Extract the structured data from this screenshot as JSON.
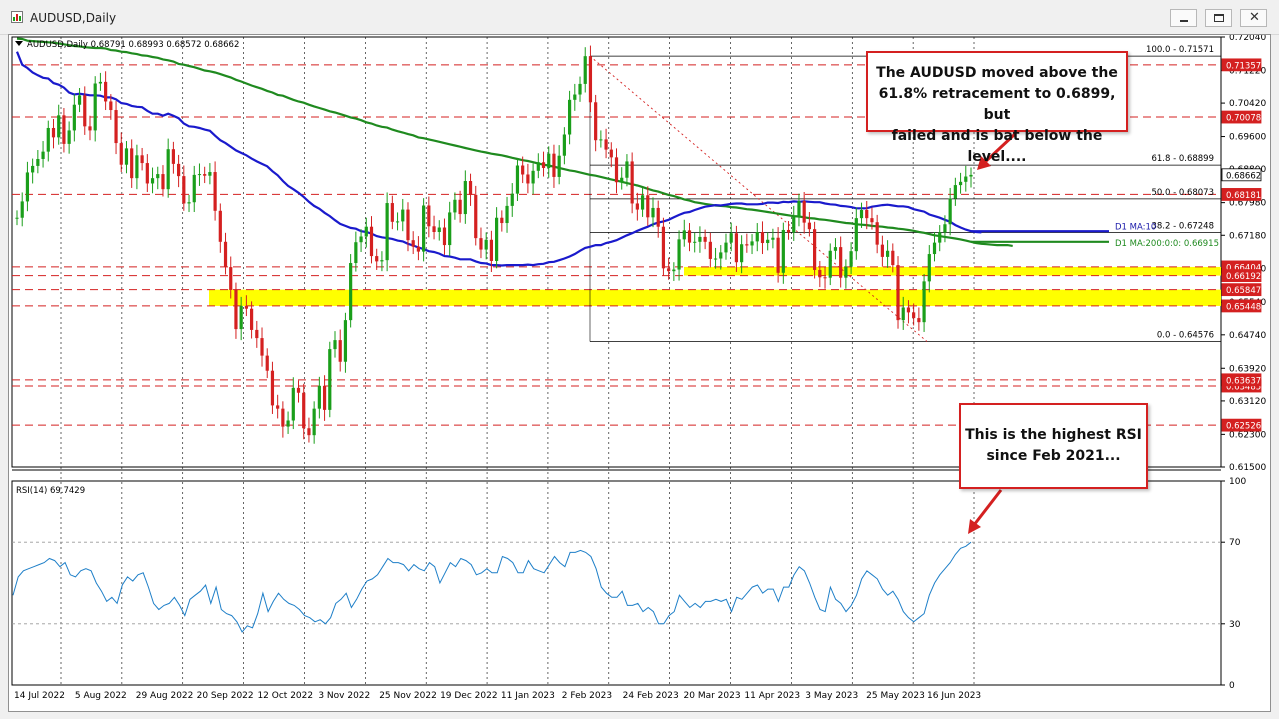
{
  "window": {
    "title": "AUDUSD,Daily"
  },
  "chart_data": {
    "type": "candlestick",
    "symbol_info": "AUDUSD,Daily  0.68791 0.68993 0.68572 0.68662",
    "price_ticks": [
      "0.72040",
      "0.71220",
      "0.70420",
      "0.69600",
      "0.68800",
      "0.67980",
      "0.67180",
      "0.66360",
      "0.65540",
      "0.64740",
      "0.63920",
      "0.63120",
      "0.62300",
      "0.61500"
    ],
    "price_range": [
      0.615,
      0.7204
    ],
    "rsi_range": [
      0,
      100
    ],
    "rsi_ticks": [
      "100",
      "70",
      "30",
      "0"
    ],
    "rsi_label": "RSI(14) 69.7429",
    "rsi_levels": [
      70,
      30
    ],
    "rsi_last": 69.7429,
    "date_labels": [
      "14 Jul 2022",
      "5 Aug 2022",
      "29 Aug 2022",
      "20 Sep 2022",
      "12 Oct 2022",
      "3 Nov 2022",
      "25 Nov 2022",
      "19 Dec 2022",
      "11 Jan 2023",
      "2 Feb 2023",
      "24 Feb 2023",
      "20 Mar 2023",
      "11 Apr 2023",
      "3 May 2023",
      "25 May 2023",
      "16 Jun 2023"
    ],
    "closes": [
      0.6761,
      0.6801,
      0.6872,
      0.6888,
      0.6905,
      0.6923,
      0.6981,
      0.6958,
      0.7012,
      0.6942,
      0.6975,
      0.7038,
      0.7061,
      0.6985,
      0.6975,
      0.709,
      0.7094,
      0.7046,
      0.7025,
      0.6944,
      0.6891,
      0.6931,
      0.6858,
      0.6914,
      0.6895,
      0.6845,
      0.6858,
      0.6868,
      0.6831,
      0.6929,
      0.6893,
      0.6863,
      0.6796,
      0.6799,
      0.6866,
      0.6868,
      0.6864,
      0.6873,
      0.6778,
      0.6702,
      0.664,
      0.6584,
      0.6488,
      0.6545,
      0.6538,
      0.6486,
      0.6466,
      0.6423,
      0.6386,
      0.6301,
      0.6293,
      0.6249,
      0.6264,
      0.6344,
      0.6332,
      0.6245,
      0.6228,
      0.6293,
      0.6349,
      0.629,
      0.6439,
      0.6461,
      0.6408,
      0.651,
      0.665,
      0.6701,
      0.6715,
      0.6739,
      0.6667,
      0.6654,
      0.6657,
      0.6797,
      0.6751,
      0.6752,
      0.6781,
      0.6706,
      0.669,
      0.6678,
      0.6791,
      0.674,
      0.6726,
      0.6737,
      0.6694,
      0.6774,
      0.6805,
      0.677,
      0.6851,
      0.6817,
      0.6711,
      0.6683,
      0.6707,
      0.6655,
      0.6761,
      0.6748,
      0.679,
      0.682,
      0.6889,
      0.6867,
      0.6845,
      0.6876,
      0.6897,
      0.6883,
      0.6918,
      0.6861,
      0.6913,
      0.6965,
      0.705,
      0.7063,
      0.7089,
      0.7157,
      0.7044,
      0.6951,
      0.6953,
      0.6928,
      0.6909,
      0.6848,
      0.6859,
      0.6899,
      0.6796,
      0.6781,
      0.6816,
      0.6762,
      0.6785,
      0.6739,
      0.6637,
      0.663,
      0.6634,
      0.6708,
      0.673,
      0.67,
      0.6702,
      0.6714,
      0.6702,
      0.666,
      0.6661,
      0.6676,
      0.67,
      0.6723,
      0.6652,
      0.6696,
      0.6693,
      0.6703,
      0.6726,
      0.6699,
      0.6707,
      0.6712,
      0.6626,
      0.6731,
      0.6725,
      0.6764,
      0.6802,
      0.6749,
      0.6733,
      0.6633,
      0.6615,
      0.6614,
      0.668,
      0.6689,
      0.6614,
      0.6641,
      0.6679,
      0.676,
      0.678,
      0.676,
      0.675,
      0.6695,
      0.6665,
      0.668,
      0.6645,
      0.651,
      0.6541,
      0.6529,
      0.6515,
      0.6505,
      0.6605,
      0.6672,
      0.67,
      0.6725,
      0.6745,
      0.6808,
      0.6841,
      0.6849,
      0.6862,
      0.6866
    ],
    "ma100": [
      0.7168,
      0.7136,
      0.7128,
      0.7117,
      0.711,
      0.7104,
      0.7102,
      0.7091,
      0.7087,
      0.708,
      0.7068,
      0.7063,
      0.7065,
      0.7063,
      0.7061,
      0.7061,
      0.706,
      0.7056,
      0.7056,
      0.7051,
      0.7042,
      0.704,
      0.7035,
      0.7033,
      0.7032,
      0.7023,
      0.7016,
      0.7016,
      0.7011,
      0.7016,
      0.7011,
      0.7005,
      0.6992,
      0.6985,
      0.6984,
      0.6981,
      0.6977,
      0.6974,
      0.6962,
      0.6951,
      0.6944,
      0.6935,
      0.6926,
      0.692,
      0.6914,
      0.6906,
      0.6899,
      0.6893,
      0.6887,
      0.6875,
      0.6865,
      0.6851,
      0.6839,
      0.6831,
      0.6822,
      0.6812,
      0.68,
      0.679,
      0.6783,
      0.6773,
      0.6765,
      0.6755,
      0.6746,
      0.6741,
      0.6736,
      0.6734,
      0.6728,
      0.6726,
      0.6722,
      0.6716,
      0.6713,
      0.6711,
      0.6709,
      0.6705,
      0.6703,
      0.6697,
      0.6693,
      0.6688,
      0.6684,
      0.6679,
      0.6677,
      0.6673,
      0.6667,
      0.6666,
      0.6663,
      0.6659,
      0.6659,
      0.6659,
      0.6654,
      0.665,
      0.6649,
      0.6645,
      0.6645,
      0.6644,
      0.6645,
      0.6645,
      0.6645,
      0.6645,
      0.6646,
      0.6645,
      0.6647,
      0.6648,
      0.6652,
      0.6653,
      0.6657,
      0.6661,
      0.6666,
      0.6672,
      0.668,
      0.6687,
      0.669,
      0.6694,
      0.6694,
      0.6699,
      0.6702,
      0.6706,
      0.6712,
      0.6718,
      0.6723,
      0.6729,
      0.6734,
      0.6739,
      0.6745,
      0.6749,
      0.6752,
      0.6756,
      0.6762,
      0.6768,
      0.6773,
      0.6775,
      0.678,
      0.6784,
      0.6788,
      0.679,
      0.6792,
      0.6791,
      0.6793,
      0.6795,
      0.6796,
      0.6796,
      0.6794,
      0.6794,
      0.6794,
      0.6795,
      0.6798,
      0.6798,
      0.6797,
      0.68,
      0.6799,
      0.6801,
      0.68,
      0.6801,
      0.68,
      0.6799,
      0.6799,
      0.6796,
      0.6794,
      0.6793,
      0.679,
      0.6789,
      0.6787,
      0.6784,
      0.6784,
      0.6784,
      0.6788,
      0.679,
      0.6792,
      0.6793,
      0.6791,
      0.6789,
      0.6789,
      0.6787,
      0.6782,
      0.6779,
      0.6776,
      0.6769,
      0.6765,
      0.6761,
      0.6756,
      0.6751,
      0.6743,
      0.6737,
      0.6732,
      0.6728,
      0.6726,
      0.6725
    ],
    "ma200": [
      0.72,
      0.7199,
      0.7195,
      0.7194,
      0.7193,
      0.7192,
      0.7191,
      0.719,
      0.7188,
      0.7186,
      0.7184,
      0.7182,
      0.7181,
      0.7179,
      0.7178,
      0.7177,
      0.7177,
      0.7176,
      0.7172,
      0.7171,
      0.7168,
      0.7167,
      0.7164,
      0.7162,
      0.7159,
      0.7158,
      0.7155,
      0.7153,
      0.7149,
      0.7147,
      0.7144,
      0.7138,
      0.7136,
      0.7133,
      0.713,
      0.7126,
      0.7122,
      0.712,
      0.7117,
      0.7113,
      0.7109,
      0.7105,
      0.7099,
      0.7095,
      0.709,
      0.7085,
      0.7081,
      0.7077,
      0.7072,
      0.7068,
      0.7062,
      0.706,
      0.7055,
      0.705,
      0.7046,
      0.7043,
      0.7038,
      0.7034,
      0.703,
      0.7026,
      0.7022,
      0.7019,
      0.7015,
      0.7011,
      0.7007,
      0.7004,
      0.7,
      0.6995,
      0.6992,
      0.6987,
      0.6984,
      0.6982,
      0.6977,
      0.6973,
      0.697,
      0.6966,
      0.6963,
      0.6958,
      0.6956,
      0.6953,
      0.695,
      0.6947,
      0.6944,
      0.6941,
      0.6938,
      0.6935,
      0.6932,
      0.6929,
      0.6926,
      0.6923,
      0.6921,
      0.6918,
      0.6916,
      0.6914,
      0.6911,
      0.6908,
      0.6905,
      0.6902,
      0.69,
      0.6897,
      0.6894,
      0.6891,
      0.6889,
      0.6886,
      0.6883,
      0.688,
      0.6877,
      0.6875,
      0.6872,
      0.6869,
      0.6866,
      0.6864,
      0.6861,
      0.6858,
      0.6855,
      0.6852,
      0.6849,
      0.6846,
      0.6843,
      0.684,
      0.6836,
      0.6832,
      0.6828,
      0.6825,
      0.6821,
      0.6817,
      0.6814,
      0.681,
      0.6806,
      0.6803,
      0.6799,
      0.6797,
      0.6795,
      0.6793,
      0.6791,
      0.679,
      0.6789,
      0.6787,
      0.6786,
      0.6784,
      0.6782,
      0.6781,
      0.6779,
      0.6777,
      0.6775,
      0.6773,
      0.6771,
      0.6769,
      0.6767,
      0.6765,
      0.6764,
      0.6762,
      0.676,
      0.6759,
      0.6757,
      0.6756,
      0.6754,
      0.6752,
      0.675,
      0.6748,
      0.6747,
      0.6745,
      0.6744,
      0.6743,
      0.6741,
      0.674,
      0.6739,
      0.6737,
      0.6736,
      0.6734,
      0.6733,
      0.6731,
      0.6729,
      0.6726,
      0.6724,
      0.6721,
      0.6718,
      0.6716,
      0.6714,
      0.6712,
      0.671,
      0.6708,
      0.6705,
      0.6702,
      0.6699,
      0.6697,
      0.6696,
      0.6695,
      0.6694,
      0.6694,
      0.6694,
      0.6692
    ],
    "rsi": [
      44,
      53,
      56,
      57,
      58,
      59,
      60,
      62,
      61,
      58,
      60,
      54,
      53,
      56,
      57,
      56,
      50,
      46,
      41,
      43,
      40,
      49,
      53,
      51,
      54,
      55,
      48,
      40,
      37,
      39,
      40,
      43,
      39,
      34,
      42,
      44,
      46,
      49,
      40,
      48,
      37,
      35,
      34,
      31,
      26,
      29,
      28,
      35,
      45,
      36,
      41,
      45,
      42,
      40,
      39,
      37,
      34,
      33,
      31,
      32,
      30,
      33,
      40,
      42,
      45,
      38,
      42,
      47,
      51,
      52,
      54,
      58,
      62,
      60,
      60,
      59,
      56,
      59,
      57,
      56,
      60,
      58,
      50,
      55,
      60,
      58,
      62,
      61,
      59,
      54,
      55,
      57,
      55,
      55,
      63,
      62,
      60,
      55,
      55,
      61,
      57,
      56,
      55,
      59,
      63,
      60,
      58,
      65,
      65,
      66,
      65,
      63,
      57,
      48,
      45,
      43,
      43,
      46,
      39,
      39,
      40,
      36,
      38,
      36,
      30,
      30,
      34,
      36,
      44,
      41,
      38,
      40,
      38,
      41,
      41,
      42,
      41,
      42,
      36,
      43,
      42,
      45,
      48,
      49,
      45,
      47,
      47,
      41,
      48,
      48,
      54,
      58,
      56,
      50,
      43,
      37,
      36,
      48,
      42,
      40,
      36,
      39,
      44,
      52,
      56,
      54,
      52,
      47,
      44,
      46,
      42,
      36,
      33,
      31,
      33,
      35,
      44,
      50,
      54,
      57,
      60,
      64,
      67,
      68,
      70
    ],
    "annotations": [
      "The AUDUSD moved above the\n61.8% retracement to 0.6899, but\nfailed and is bat below the level....",
      "This is the highest RSI\nsince Feb 2021..."
    ],
    "hlines_price": [
      {
        "label": "0.71357",
        "color": "#d42020"
      },
      {
        "label": "0.70078",
        "color": "#d42020"
      },
      {
        "label": "0.68181",
        "color": "#d42020"
      },
      {
        "label": "0.66404",
        "color": "#d42020"
      },
      {
        "label": "0.66192",
        "color": "#d42020"
      },
      {
        "label": "0.65847",
        "color": "#d42020"
      },
      {
        "label": "0.65448",
        "color": "#d42020"
      },
      {
        "label": "0.63485",
        "color": "#d42020"
      },
      {
        "label": "0.63637",
        "color": "#d42020"
      },
      {
        "label": "0.62526",
        "color": "#d42020"
      },
      {
        "label": "0.68662",
        "color": "#ffffff"
      }
    ],
    "fib": [
      {
        "label": "100.0 - 0.71571"
      },
      {
        "label": "61.8 - 0.68899"
      },
      {
        "label": "50.0 - 0.68073"
      },
      {
        "label": "38.2 - 0.67248"
      },
      {
        "label": "0.0 - 0.64576"
      }
    ],
    "ma_labels": [
      {
        "label": "D1 MA:10",
        "color": "#1a1aaa"
      },
      {
        "label": "D1 MA:200:0:0: 0.66915",
        "color": "#1f8a1f"
      }
    ],
    "colors": {
      "bull": "#1a9e1a",
      "bear": "#d42020",
      "ma100": "#1a1acc",
      "ma200": "#1f8a1f",
      "rsi": "#1e7fc8",
      "zone": "#ffff00"
    }
  }
}
